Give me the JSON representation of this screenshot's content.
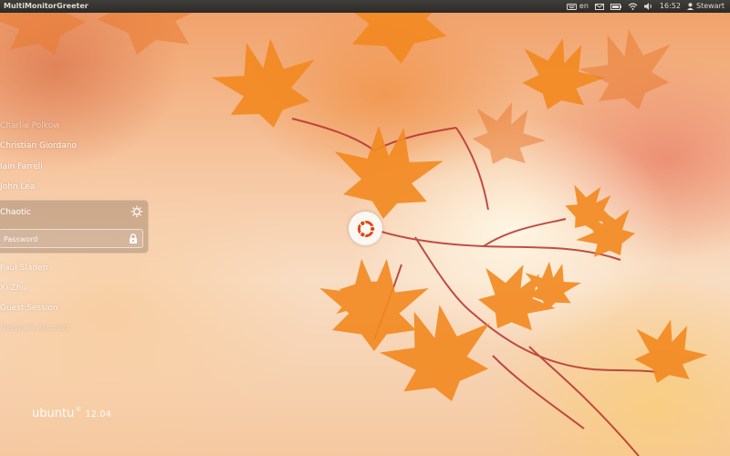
{
  "topbar": {
    "title": "MultiMonitorGreeter",
    "keyboard_layout": "en",
    "time": "16:52",
    "user": "Stewart",
    "icons": [
      "keyboard-icon",
      "mail-icon",
      "battery-icon",
      "wifi-icon",
      "volume-icon",
      "user-icon"
    ]
  },
  "users": {
    "above": [
      "Charlie Polkow",
      "Christian Giordano",
      "Iain Farrell",
      "John Lea"
    ],
    "selected": "Chaotic",
    "below": [
      "Paul Sladen",
      "Xi Zhu",
      "Guest Session",
      "Network Account"
    ]
  },
  "password": {
    "placeholder": "Password",
    "value": ""
  },
  "brand": {
    "name": "ubuntu",
    "registered": "®",
    "version": "12.04"
  },
  "colors": {
    "topbar": "#3c3b37",
    "ubuntu_orange": "#dd4814",
    "leaf": "#f28a22"
  }
}
